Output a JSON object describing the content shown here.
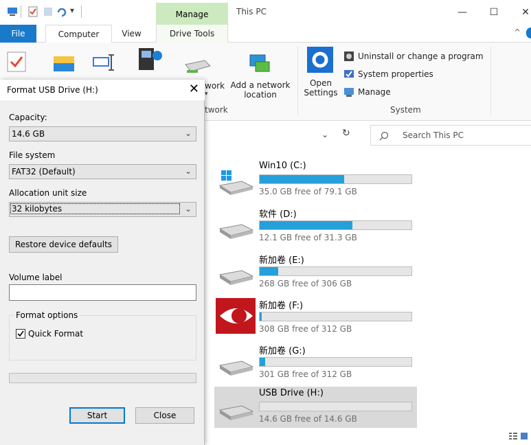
{
  "window": {
    "title": "This PC",
    "contextual_tab": "Manage",
    "controls": {
      "minimize": "—",
      "maximize": "☐",
      "close": "✕"
    },
    "help": "^"
  },
  "tabs": {
    "file": "File",
    "computer": "Computer",
    "view": "View",
    "drive_tools": "Drive Tools"
  },
  "ribbon": {
    "network_partial": "work",
    "add_network_location": [
      "Add a network",
      "location"
    ],
    "network_group_partial": "twork",
    "open_settings": [
      "Open",
      "Settings"
    ],
    "uninstall": "Uninstall or change a program",
    "system_properties": "System properties",
    "manage": "Manage",
    "system_group": "System"
  },
  "search": {
    "placeholder": "Search This PC"
  },
  "drives": [
    {
      "name": "Win10 (C:)",
      "free": "35.0 GB free of 79.1 GB",
      "used_fraction": 0.557
    },
    {
      "name": "软件 (D:)",
      "free": "12.1 GB free of 31.3 GB",
      "used_fraction": 0.613
    },
    {
      "name": "新加卷 (E:)",
      "free": "268 GB free of 306 GB",
      "used_fraction": 0.124
    },
    {
      "name": "新加卷 (F:)",
      "free": "308 GB free of 312 GB",
      "used_fraction": 0.013
    },
    {
      "name": "新加卷 (G:)",
      "free": "301 GB free of 312 GB",
      "used_fraction": 0.035
    },
    {
      "name": "USB Drive (H:)",
      "free": "14.6 GB free of 14.6 GB",
      "used_fraction": 0.0
    }
  ],
  "dialog": {
    "title": "Format USB Drive (H:)",
    "close": "✕",
    "capacity_label": "Capacity:",
    "capacity_value": "14.6 GB",
    "filesystem_label": "File system",
    "filesystem_value": "FAT32 (Default)",
    "allocation_label": "Allocation unit size",
    "allocation_value": "32 kilobytes",
    "restore_defaults": "Restore device defaults",
    "volume_label": "Volume label",
    "volume_value": "",
    "format_options": "Format options",
    "quick_format": "Quick Format",
    "quick_format_checked": true,
    "progress": 0,
    "start": "Start",
    "close_button": "Close"
  },
  "colors": {
    "accent": "#1979ca",
    "manage_tab": "#cde9bf",
    "bar_fill": "#26a0da",
    "selected_row": "#d9d9d9"
  }
}
